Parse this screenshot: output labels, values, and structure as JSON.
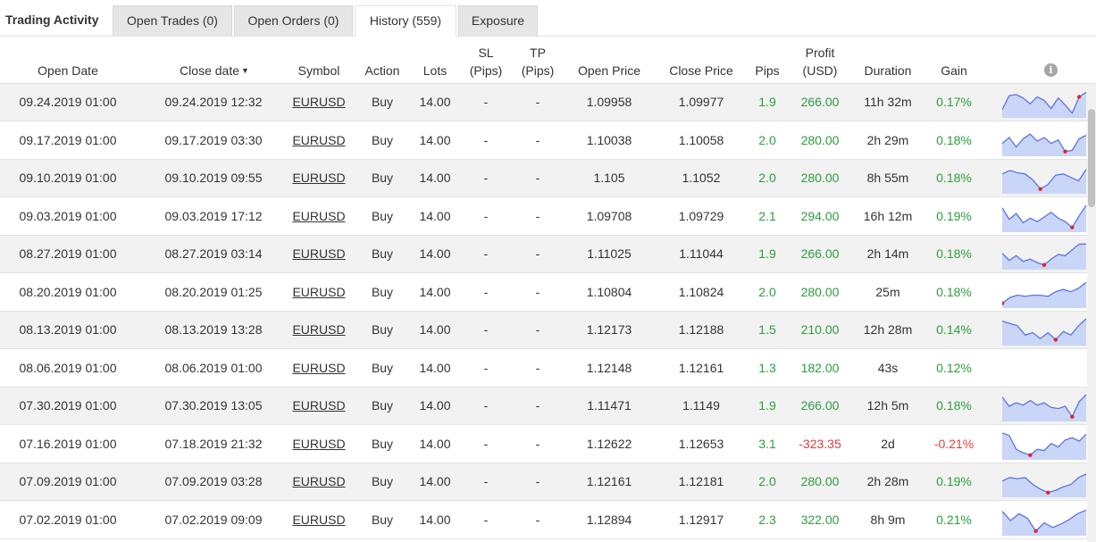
{
  "tabs": {
    "title": "Trading Activity",
    "items": [
      {
        "label": "Open Trades (0)"
      },
      {
        "label": "Open Orders (0)"
      },
      {
        "label": "History (559)"
      },
      {
        "label": "Exposure"
      }
    ],
    "active_index": 2
  },
  "table": {
    "headers": {
      "open_date": "Open Date",
      "close_date": "Close date",
      "sort_indicator": "▼",
      "symbol": "Symbol",
      "action": "Action",
      "lots": "Lots",
      "sl_1": "SL",
      "sl_2": "(Pips)",
      "tp_1": "TP",
      "tp_2": "(Pips)",
      "open_price": "Open Price",
      "close_price": "Close Price",
      "pips": "Pips",
      "profit_1": "Profit",
      "profit_2": "(USD)",
      "duration": "Duration",
      "gain": "Gain",
      "info_icon": "i"
    },
    "rows": [
      {
        "open_date": "09.24.2019 01:00",
        "close_date": "09.24.2019 12:32",
        "symbol": "EURUSD",
        "action": "Buy",
        "lots": "14.00",
        "sl": "-",
        "tp": "-",
        "open_price": "1.09958",
        "close_price": "1.09977",
        "pips": "1.9",
        "profit": "266.00",
        "duration": "11h 32m",
        "gain": "0.17%",
        "positive": true,
        "spark": [
          0.8,
          0.2,
          0.15,
          0.3,
          0.55,
          0.25,
          0.4,
          0.75,
          0.3,
          0.6,
          0.95,
          0.25,
          0.05
        ],
        "spark_low": 11
      },
      {
        "open_date": "09.17.2019 01:00",
        "close_date": "09.17.2019 03:30",
        "symbol": "EURUSD",
        "action": "Buy",
        "lots": "14.00",
        "sl": "-",
        "tp": "-",
        "open_price": "1.10038",
        "close_price": "1.10058",
        "pips": "2.0",
        "profit": "280.00",
        "duration": "2h 29m",
        "gain": "0.18%",
        "positive": true,
        "spark": [
          0.6,
          0.35,
          0.75,
          0.4,
          0.2,
          0.5,
          0.35,
          0.6,
          0.45,
          0.95,
          0.9,
          0.4,
          0.25
        ],
        "spark_low": 9
      },
      {
        "open_date": "09.10.2019 01:00",
        "close_date": "09.10.2019 09:55",
        "symbol": "EURUSD",
        "action": "Buy",
        "lots": "14.00",
        "sl": "-",
        "tp": "-",
        "open_price": "1.105",
        "close_price": "1.1052",
        "pips": "2.0",
        "profit": "280.00",
        "duration": "8h 55m",
        "gain": "0.18%",
        "positive": true,
        "spark": [
          0.3,
          0.15,
          0.25,
          0.3,
          0.55,
          0.95,
          0.75,
          0.35,
          0.3,
          0.45,
          0.6,
          0.1
        ],
        "spark_low": 5
      },
      {
        "open_date": "09.03.2019 01:00",
        "close_date": "09.03.2019 17:12",
        "symbol": "EURUSD",
        "action": "Buy",
        "lots": "14.00",
        "sl": "-",
        "tp": "-",
        "open_price": "1.09708",
        "close_price": "1.09729",
        "pips": "2.1",
        "profit": "294.00",
        "duration": "16h 12m",
        "gain": "0.19%",
        "positive": true,
        "spark": [
          0.1,
          0.6,
          0.35,
          0.75,
          0.55,
          0.7,
          0.5,
          0.3,
          0.55,
          0.7,
          0.95,
          0.45,
          0.0
        ],
        "spark_low": 10
      },
      {
        "open_date": "08.27.2019 01:00",
        "close_date": "08.27.2019 03:14",
        "symbol": "EURUSD",
        "action": "Buy",
        "lots": "14.00",
        "sl": "-",
        "tp": "-",
        "open_price": "1.11025",
        "close_price": "1.11044",
        "pips": "1.9",
        "profit": "266.00",
        "duration": "2h 14m",
        "gain": "0.18%",
        "positive": true,
        "spark": [
          0.45,
          0.75,
          0.55,
          0.8,
          0.7,
          0.85,
          0.95,
          0.7,
          0.5,
          0.55,
          0.3,
          0.05,
          0.05
        ],
        "spark_low": 6
      },
      {
        "open_date": "08.20.2019 01:00",
        "close_date": "08.20.2019 01:25",
        "symbol": "EURUSD",
        "action": "Buy",
        "lots": "14.00",
        "sl": "-",
        "tp": "-",
        "open_price": "1.10804",
        "close_price": "1.10824",
        "pips": "2.0",
        "profit": "280.00",
        "duration": "25m",
        "gain": "0.18%",
        "positive": true,
        "spark": [
          0.95,
          0.7,
          0.6,
          0.65,
          0.6,
          0.6,
          0.65,
          0.45,
          0.35,
          0.45,
          0.3,
          0.05
        ],
        "spark_low": 0
      },
      {
        "open_date": "08.13.2019 01:00",
        "close_date": "08.13.2019 13:28",
        "symbol": "EURUSD",
        "action": "Buy",
        "lots": "14.00",
        "sl": "-",
        "tp": "-",
        "open_price": "1.12173",
        "close_price": "1.12188",
        "pips": "1.5",
        "profit": "210.00",
        "duration": "12h 28m",
        "gain": "0.14%",
        "positive": true,
        "spark": [
          0.1,
          0.2,
          0.3,
          0.7,
          0.6,
          0.85,
          0.6,
          0.9,
          0.55,
          0.7,
          0.3,
          0.0
        ],
        "spark_low": 7
      },
      {
        "open_date": "08.06.2019 01:00",
        "close_date": "08.06.2019 01:00",
        "symbol": "EURUSD",
        "action": "Buy",
        "lots": "14.00",
        "sl": "-",
        "tp": "-",
        "open_price": "1.12148",
        "close_price": "1.12161",
        "pips": "1.3",
        "profit": "182.00",
        "duration": "43s",
        "gain": "0.12%",
        "positive": true,
        "spark": [],
        "spark_low": -1
      },
      {
        "open_date": "07.30.2019 01:00",
        "close_date": "07.30.2019 13:05",
        "symbol": "EURUSD",
        "action": "Buy",
        "lots": "14.00",
        "sl": "-",
        "tp": "-",
        "open_price": "1.11471",
        "close_price": "1.1149",
        "pips": "1.9",
        "profit": "266.00",
        "duration": "12h 5m",
        "gain": "0.18%",
        "positive": true,
        "spark": [
          0.1,
          0.5,
          0.35,
          0.45,
          0.25,
          0.45,
          0.35,
          0.55,
          0.6,
          0.5,
          0.95,
          0.3,
          0.0
        ],
        "spark_low": 10
      },
      {
        "open_date": "07.16.2019 01:00",
        "close_date": "07.18.2019 21:32",
        "symbol": "EURUSD",
        "action": "Buy",
        "lots": "14.00",
        "sl": "-",
        "tp": "-",
        "open_price": "1.12622",
        "close_price": "1.12653",
        "pips": "3.1",
        "profit": "-323.35",
        "duration": "2d",
        "gain": "-0.21%",
        "positive": false,
        "spark": [
          0.0,
          0.1,
          0.7,
          0.85,
          0.95,
          0.7,
          0.75,
          0.45,
          0.6,
          0.3,
          0.2,
          0.35,
          0.05
        ],
        "spark_low": 4
      },
      {
        "open_date": "07.09.2019 01:00",
        "close_date": "07.09.2019 03:28",
        "symbol": "EURUSD",
        "action": "Buy",
        "lots": "14.00",
        "sl": "-",
        "tp": "-",
        "open_price": "1.12161",
        "close_price": "1.12181",
        "pips": "2.0",
        "profit": "280.00",
        "duration": "2h 28m",
        "gain": "0.19%",
        "positive": true,
        "spark": [
          0.45,
          0.3,
          0.35,
          0.3,
          0.6,
          0.8,
          0.95,
          0.85,
          0.7,
          0.6,
          0.3,
          0.15
        ],
        "spark_low": 6
      },
      {
        "open_date": "07.02.2019 01:00",
        "close_date": "07.02.2019 09:09",
        "symbol": "EURUSD",
        "action": "Buy",
        "lots": "14.00",
        "sl": "-",
        "tp": "-",
        "open_price": "1.12894",
        "close_price": "1.12917",
        "pips": "2.3",
        "profit": "322.00",
        "duration": "8h 9m",
        "gain": "0.21%",
        "positive": true,
        "spark": [
          0.1,
          0.5,
          0.2,
          0.4,
          0.95,
          0.6,
          0.8,
          0.65,
          0.45,
          0.2,
          0.05
        ],
        "spark_low": 4
      }
    ]
  },
  "colors": {
    "positive": "#2d9c3c",
    "negative": "#e03b3b",
    "spark_fill": "#c9d6f7",
    "spark_line": "#5b73e8",
    "spark_marker": "#e8202a"
  }
}
